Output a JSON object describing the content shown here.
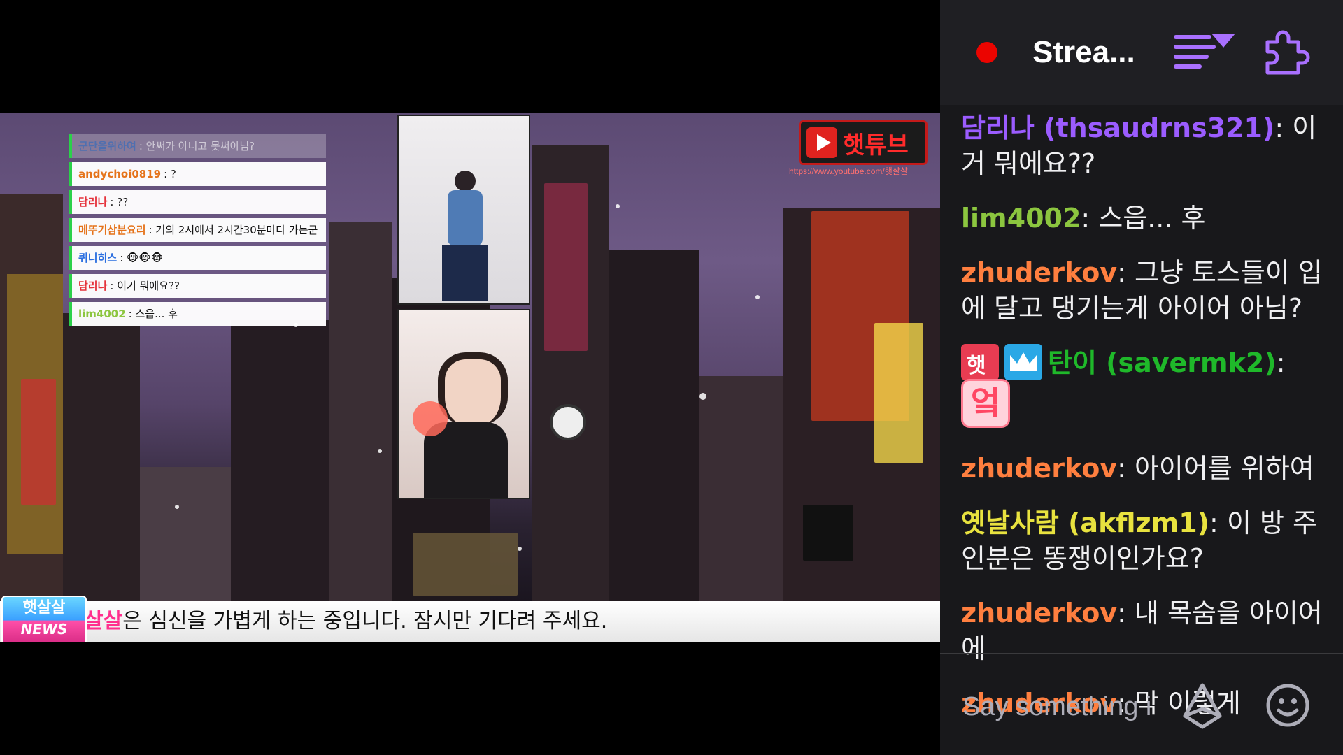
{
  "chat_panel": {
    "title": "Strea...",
    "input_placeholder": "Say something i",
    "messages": [
      {
        "user": "담리나 (thsaudrns321)",
        "color": "#9b5cff",
        "sep": ": ",
        "text": "이거 뭐에요??"
      },
      {
        "user": "lim4002",
        "color": "#8cc63f",
        "sep": ": ",
        "text": "스읍... 후"
      },
      {
        "user": "zhuderkov",
        "color": "#ff7f3f",
        "sep": ": ",
        "text": "그냥 토스들이 입에 달고 댕기는게 아이어 아님?"
      },
      {
        "user": "탄이 (savermk2)",
        "color": "#1fb82a",
        "sep": ": ",
        "emote": "엌"
      },
      {
        "user": "zhuderkov",
        "color": "#ff7f3f",
        "sep": ": ",
        "text": "아이어를 위하여"
      },
      {
        "user": "옛날사람 (akflzm1)",
        "color": "#e8e23f",
        "sep": ": ",
        "text": "이 방 주인분은 똥쟁이인가요?"
      },
      {
        "user": "zhuderkov",
        "color": "#ff7f3f",
        "sep": ": ",
        "text": "내 목숨을 아이어에"
      },
      {
        "user": "zhuderkov",
        "color": "#ff7f3f",
        "sep": ": ",
        "text": "막 이렇게"
      }
    ]
  },
  "stream_overlay": {
    "chat": [
      {
        "name": "군단을위하여",
        "text": "안써가 아니고 못써아님?",
        "faded": true
      },
      {
        "name": "andychoi0819",
        "text": "?"
      },
      {
        "name": "담리나",
        "text": "??"
      },
      {
        "name": "메뚜기삼분요리",
        "text": "거의 2시에서 2시간30분마다 가는군"
      },
      {
        "name": "퀴니히스",
        "text": "🐵🐵🐵"
      },
      {
        "name": "담리나",
        "text": "이거 뭐에요??"
      },
      {
        "name": "lim4002",
        "text": "스읍... 후"
      }
    ],
    "logo_text": "햇튜브",
    "logo_url": "https://www.youtube.com/햇살살",
    "badge_top": "햇살살",
    "badge_bottom": "NEWS",
    "ticker_highlight": "살살",
    "ticker_text": "은 심신을 가볍게 하는 중입니다. 잠시만 기다려 주세요."
  },
  "colors": {
    "live": "#eb0400",
    "panel_bg": "#18181b",
    "accent": "#9147ff"
  },
  "icons": [
    "live-dot-icon",
    "chat-sort-icon",
    "extensions-puzzle-icon",
    "bits-icon",
    "emote-smiley-icon"
  ]
}
